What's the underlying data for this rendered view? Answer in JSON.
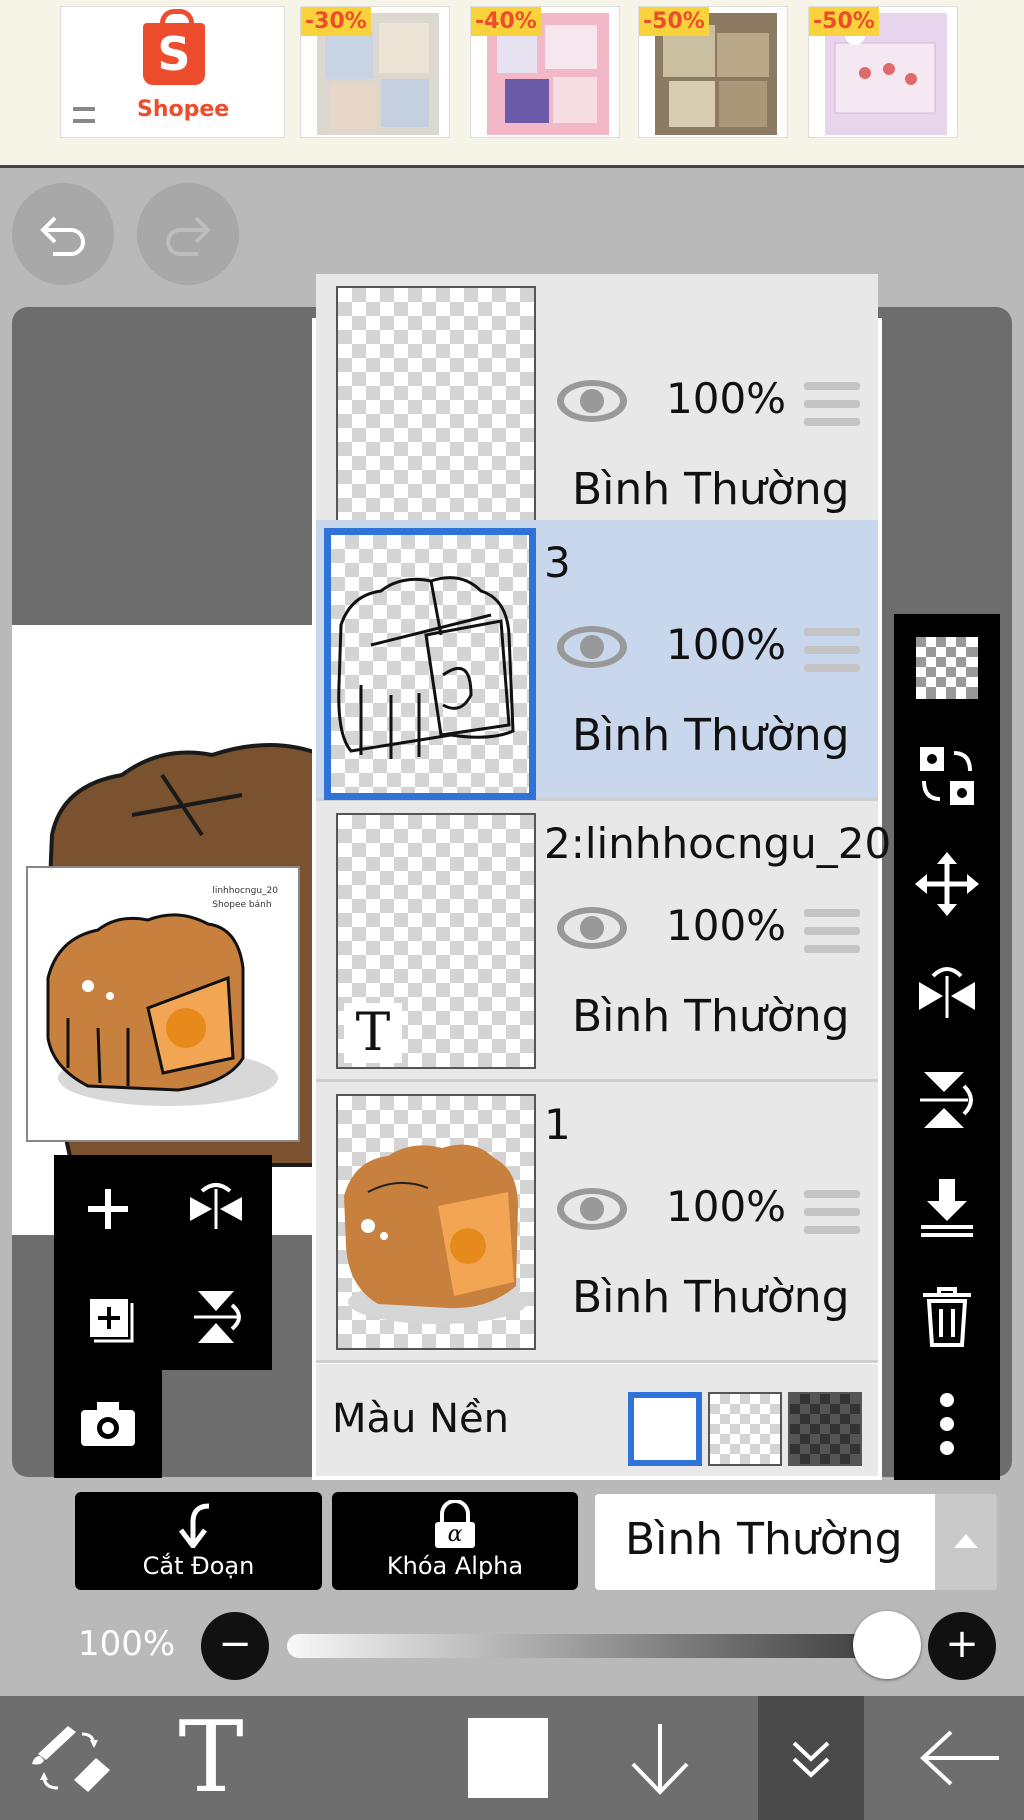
{
  "ad_banner": {
    "brand": "Shopee",
    "products": [
      {
        "discount": "-30%"
      },
      {
        "discount": "-40%"
      },
      {
        "discount": "-50%"
      },
      {
        "discount": "-50%"
      }
    ]
  },
  "preview": {
    "watermark_line1": "linhhocngu_20",
    "watermark_line2": "Shopee bánh"
  },
  "layers": [
    {
      "name": "",
      "opacity": "100%",
      "blend": "Bình Thường",
      "selected": false
    },
    {
      "name": "3",
      "opacity": "100%",
      "blend": "Bình Thường",
      "selected": true
    },
    {
      "name": "2:linhhocngu_20",
      "opacity": "100%",
      "blend": "Bình Thường",
      "selected": false
    },
    {
      "name": "1",
      "opacity": "100%",
      "blend": "Bình Thường",
      "selected": false
    }
  ],
  "background": {
    "label": "Màu Nền",
    "options": [
      "white",
      "transparent",
      "dark"
    ],
    "selected": "white"
  },
  "text_layer_icon": "T",
  "toolbar": {
    "cut_label": "Cắt Đoạn",
    "alpha_label": "Khóa Alpha",
    "alpha_symbol": "α",
    "blend_mode": "Bình Thường",
    "opacity_label": "100%",
    "opacity_value": 1.0,
    "minus": "−",
    "plus": "+"
  },
  "bottom_bar": {
    "text_tool": "T",
    "current_color": "#ffffff"
  },
  "colors": {
    "selected_blue": "#2f73d9",
    "selected_row": "#c9d7ec",
    "shopee_orange": "#ee4d2d",
    "mooncake_fill": "#c8803e",
    "mooncake_yolk": "#f2a654"
  }
}
